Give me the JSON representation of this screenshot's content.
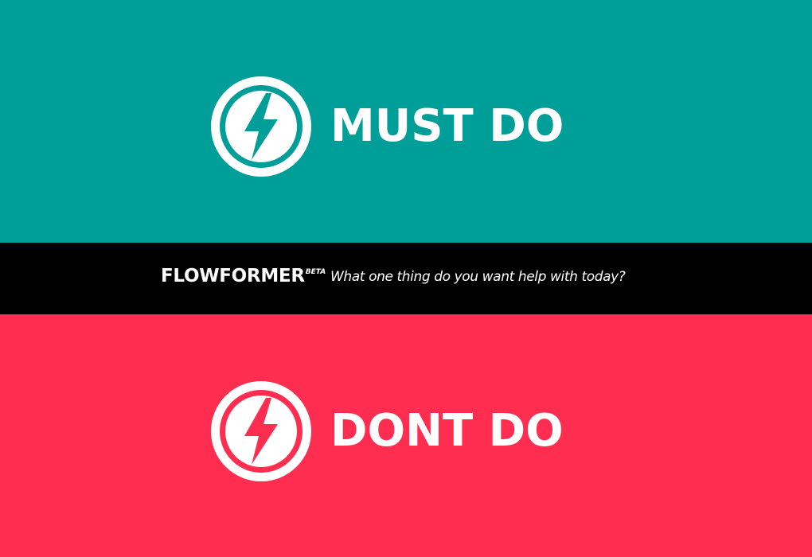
{
  "colors": {
    "must_do_bg": "#009e98",
    "bar_bg": "#000000",
    "dont_do_bg": "#ff2e51",
    "text": "#ffffff"
  },
  "must_do": {
    "label": "MUST DO",
    "icon": "lightning-bolt-icon"
  },
  "header": {
    "brand": "FLOWFORMER",
    "badge": "BETA",
    "prompt": "What one thing do you want help with today?"
  },
  "dont_do": {
    "label": "DONT DO",
    "icon": "lightning-bolt-icon"
  }
}
